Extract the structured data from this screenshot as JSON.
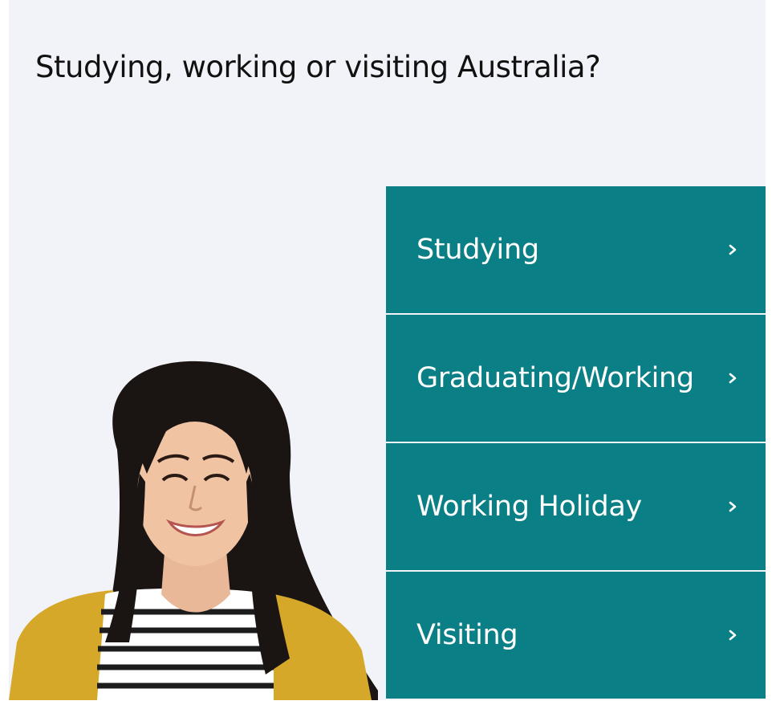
{
  "page": {
    "heading": "Studying, working or visiting Australia?"
  },
  "colors": {
    "panel_background": "#f2f3f8",
    "menu_background": "#0a7f86",
    "menu_text": "#ffffff",
    "heading_text": "#111111"
  },
  "photo": {
    "description_icon": "smiling-woman-photo"
  },
  "menu": {
    "items": [
      {
        "label": "Studying",
        "icon": "chevron-right-icon"
      },
      {
        "label": "Graduating/Working",
        "icon": "chevron-right-icon"
      },
      {
        "label": "Working Holiday",
        "icon": "chevron-right-icon"
      },
      {
        "label": "Visiting",
        "icon": "chevron-right-icon"
      }
    ]
  }
}
